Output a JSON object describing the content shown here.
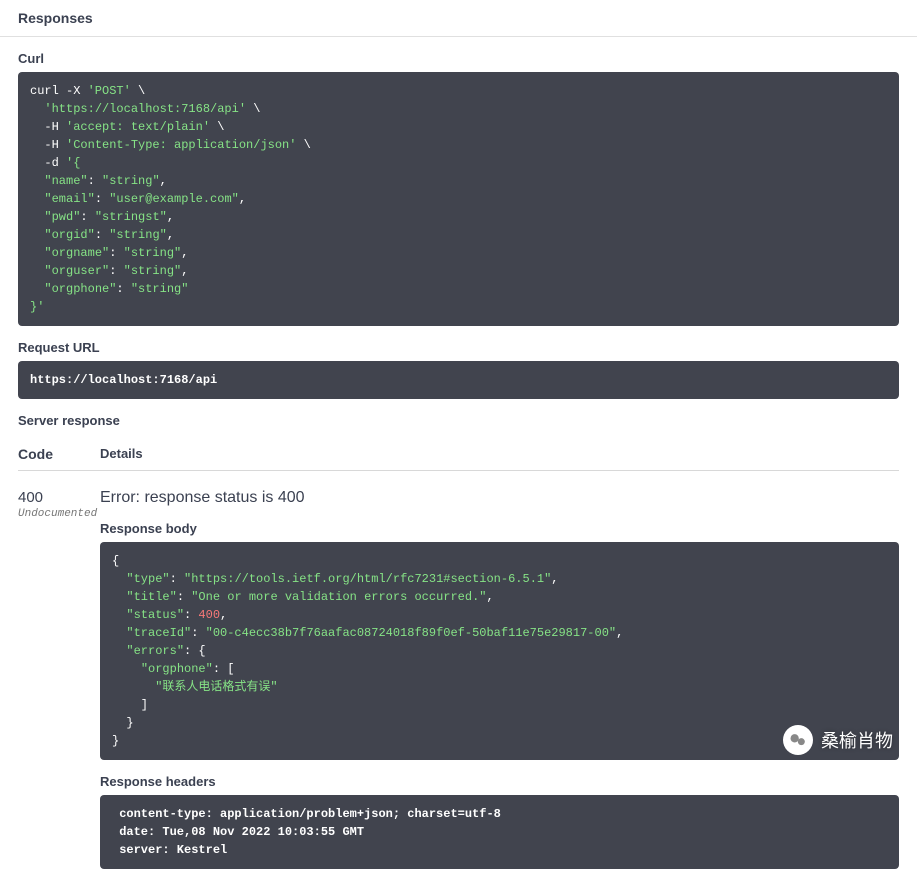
{
  "header": {
    "title": "Responses"
  },
  "curl": {
    "label": "Curl",
    "cmd_prefix": "curl -X ",
    "method": "'POST'",
    "url": "'https://localhost:7168/api'",
    "h_accept": "'accept: text/plain'",
    "h_ctype": "'Content-Type: application/json'",
    "body_open": "'{",
    "name_k": "\"name\"",
    "name_v": "\"string\"",
    "email_k": "\"email\"",
    "email_v": "\"user@example.com\"",
    "pwd_k": "\"pwd\"",
    "pwd_v": "\"stringst\"",
    "orgid_k": "\"orgid\"",
    "orgid_v": "\"string\"",
    "orgname_k": "\"orgname\"",
    "orgname_v": "\"string\"",
    "orguser_k": "\"orguser\"",
    "orguser_v": "\"string\"",
    "orgphone_k": "\"orgphone\"",
    "orgphone_v": "\"string\"",
    "body_close": "}'"
  },
  "request_url": {
    "label": "Request URL",
    "value": "https://localhost:7168/api"
  },
  "server_response": {
    "label": "Server response"
  },
  "table": {
    "code": "Code",
    "details": "Details"
  },
  "response": {
    "code": "400",
    "undocumented": "Undocumented",
    "error": "Error: response status is 400",
    "body_label": "Response body",
    "body": {
      "type_k": "\"type\"",
      "type_v": "\"https://tools.ietf.org/html/rfc7231#section-6.5.1\"",
      "title_k": "\"title\"",
      "title_v": "\"One or more validation errors occurred.\"",
      "status_k": "\"status\"",
      "status_v": "400",
      "traceId_k": "\"traceId\"",
      "traceId_v": "\"00-c4ecc38b7f76aafac08724018f89f0ef-50baf11e75e29817-00\"",
      "errors_k": "\"errors\"",
      "orgphone_k": "\"orgphone\"",
      "orgphone_msg": "\"联系人电话格式有误\""
    },
    "headers_label": "Response headers",
    "headers": " content-type: application/problem+json; charset=utf-8 \n date: Tue,08 Nov 2022 10:03:55 GMT \n server: Kestrel "
  },
  "watermark": {
    "text": "桑榆肖物"
  }
}
